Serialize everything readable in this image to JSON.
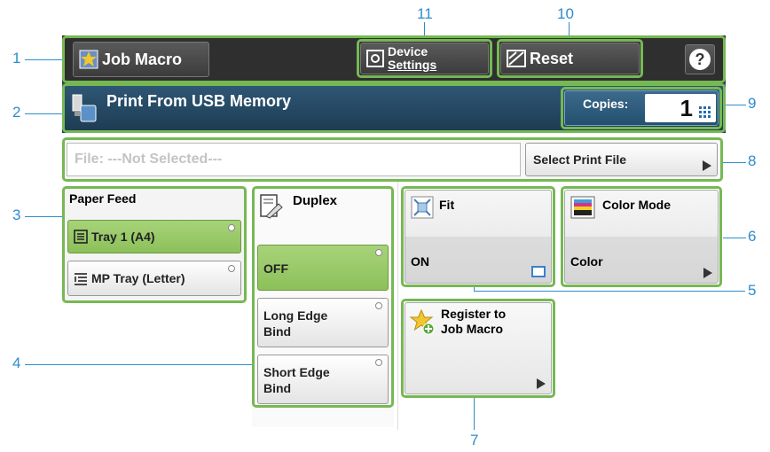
{
  "header": {
    "job_macro_label": "Job Macro",
    "device_settings_line1": "Device",
    "device_settings_line2": "Settings",
    "reset_label": "Reset",
    "help_glyph": "?"
  },
  "title_bar": {
    "title": "Print From USB Memory",
    "copies_label": "Copies:",
    "copies_value": "1"
  },
  "file_row": {
    "file_placeholder": "File: ---Not Selected---",
    "select_button_label": "Select Print File"
  },
  "paper_feed": {
    "heading": "Paper Feed",
    "options": [
      {
        "label": "Tray 1 (A4)",
        "selected": true
      },
      {
        "label": "MP Tray (Letter)",
        "selected": false
      }
    ]
  },
  "duplex": {
    "heading": "Duplex",
    "options": [
      {
        "label": "OFF",
        "selected": true
      },
      {
        "label_line1": "Long Edge",
        "label_line2": "Bind",
        "selected": false
      },
      {
        "label_line1": "Short Edge",
        "label_line2": "Bind",
        "selected": false
      }
    ]
  },
  "fit": {
    "heading": "Fit",
    "value": "ON"
  },
  "color_mode": {
    "heading": "Color Mode",
    "value": "Color"
  },
  "register_macro": {
    "line1": "Register to",
    "line2": "Job Macro"
  },
  "callouts": [
    "1",
    "2",
    "3",
    "4",
    "5",
    "6",
    "7",
    "8",
    "9",
    "10",
    "11"
  ],
  "colors": {
    "highlight": "#76b853",
    "callout": "#2d8ccd",
    "selected_green": "#9ccb6b",
    "title_bar": "#244660"
  },
  "icons": [
    "star-macro-icon",
    "device-settings-icon",
    "reset-icon",
    "help-icon",
    "usb-memory-icon",
    "keypad-icon",
    "tray-icon",
    "mp-tray-icon",
    "duplex-icon",
    "fit-icon",
    "color-mode-icon",
    "register-star-icon"
  ]
}
